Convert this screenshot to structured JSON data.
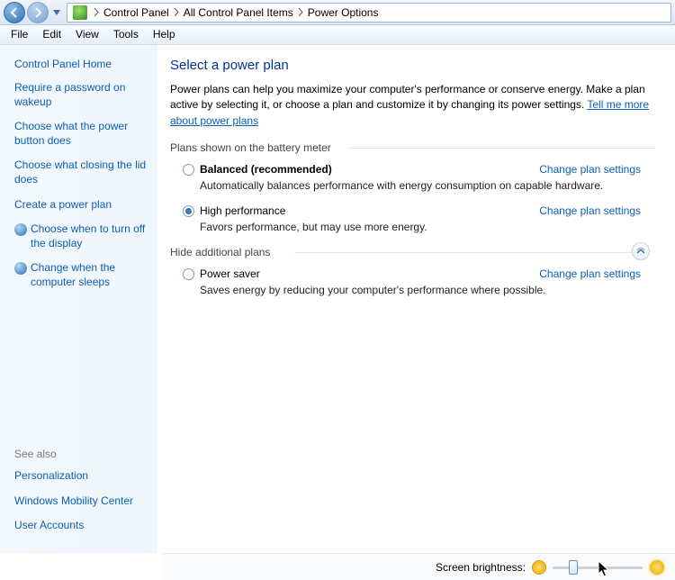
{
  "breadcrumbs": [
    "Control Panel",
    "All Control Panel Items",
    "Power Options"
  ],
  "menu": {
    "file": "File",
    "edit": "Edit",
    "view": "View",
    "tools": "Tools",
    "help": "Help"
  },
  "sidebar": {
    "home": "Control Panel Home",
    "items": [
      "Require a password on wakeup",
      "Choose what the power button does",
      "Choose what closing the lid does",
      "Create a power plan",
      "Choose when to turn off the display",
      "Change when the computer sleeps"
    ],
    "seealso_h": "See also",
    "seealso": [
      "Personalization",
      "Windows Mobility Center",
      "User Accounts"
    ]
  },
  "main": {
    "title": "Select a power plan",
    "intro": "Power plans can help you maximize your computer's performance or conserve energy. Make a plan active by selecting it, or choose a plan and customize it by changing its power settings. ",
    "intro_link": "Tell me more about power plans",
    "group1": "Plans shown on the battery meter",
    "group2": "Hide additional plans",
    "change": "Change plan settings",
    "plans": [
      {
        "name": "Balanced (recommended)",
        "desc": "Automatically balances performance with energy consumption on capable hardware.",
        "selected": false,
        "bold": true
      },
      {
        "name": "High performance",
        "desc": "Favors performance, but may use more energy.",
        "selected": true,
        "bold": false
      },
      {
        "name": "Power saver",
        "desc": "Saves energy by reducing your computer's performance where possible.",
        "selected": false,
        "bold": false
      }
    ]
  },
  "footer": {
    "label": "Screen brightness:"
  }
}
